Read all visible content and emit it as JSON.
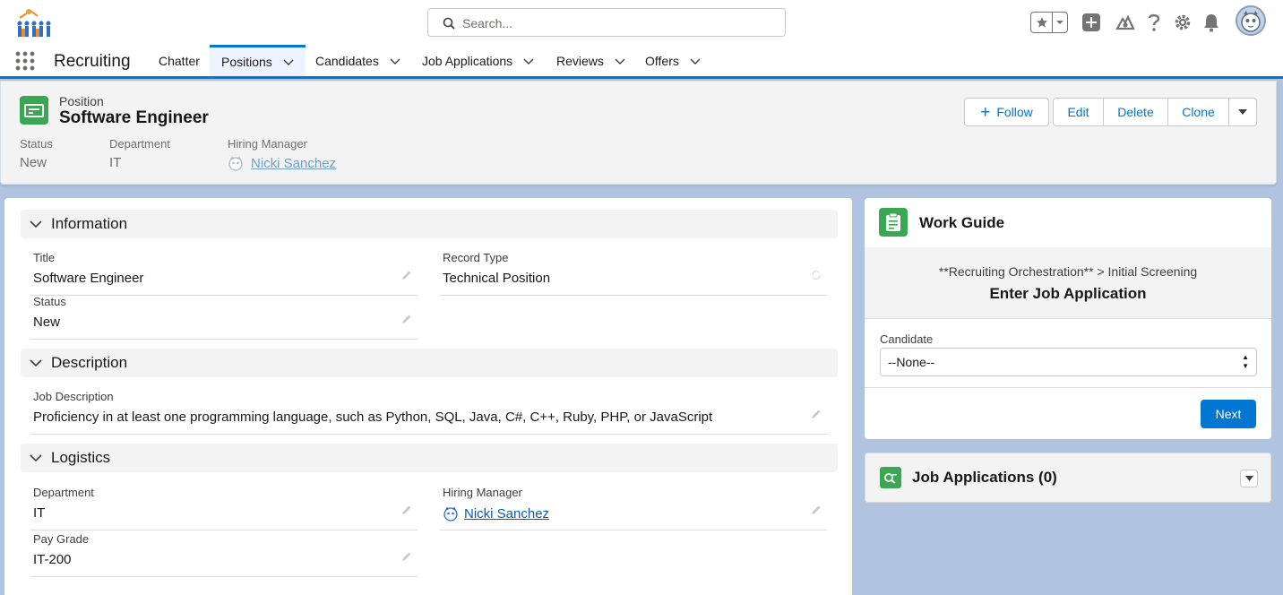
{
  "search": {
    "placeholder": "Search..."
  },
  "app": {
    "name": "Recruiting"
  },
  "nav": [
    {
      "label": "Chatter",
      "has_menu": false
    },
    {
      "label": "Positions",
      "has_menu": true,
      "active": true
    },
    {
      "label": "Candidates",
      "has_menu": true
    },
    {
      "label": "Job Applications",
      "has_menu": true
    },
    {
      "label": "Reviews",
      "has_menu": true
    },
    {
      "label": "Offers",
      "has_menu": true
    }
  ],
  "record": {
    "object_type": "Position",
    "name": "Software Engineer",
    "actions": {
      "follow": "Follow",
      "edit": "Edit",
      "delete": "Delete",
      "clone": "Clone"
    },
    "highlights": [
      {
        "label": "Status",
        "value": "New"
      },
      {
        "label": "Department",
        "value": "IT"
      },
      {
        "label": "Hiring Manager",
        "value": "Nicki Sanchez"
      }
    ]
  },
  "sections": {
    "information": {
      "title": "Information",
      "title_label": "Title",
      "title_value": "Software Engineer",
      "record_type_label": "Record Type",
      "record_type_value": "Technical Position",
      "status_label": "Status",
      "status_value": "New"
    },
    "description": {
      "title": "Description",
      "job_description_label": "Job Description",
      "job_description_value": "Proficiency in at least one programming language, such as Python, SQL, Java, C#, C++, Ruby, PHP, or JavaScript"
    },
    "logistics": {
      "title": "Logistics",
      "department_label": "Department",
      "department_value": "IT",
      "hiring_manager_label": "Hiring Manager",
      "hiring_manager_value": "Nicki Sanchez",
      "pay_grade_label": "Pay Grade",
      "pay_grade_value": "IT-200"
    }
  },
  "work_guide": {
    "title": "Work Guide",
    "step": "**Recruiting Orchestration** > Initial Screening",
    "screen_title": "Enter Job Application",
    "candidate_label": "Candidate",
    "candidate_value": "--None--",
    "next_label": "Next"
  },
  "job_applications": {
    "title": "Job Applications (0)"
  },
  "colors": {
    "brand": "#0176d3",
    "record_icon": "#3ba755"
  }
}
